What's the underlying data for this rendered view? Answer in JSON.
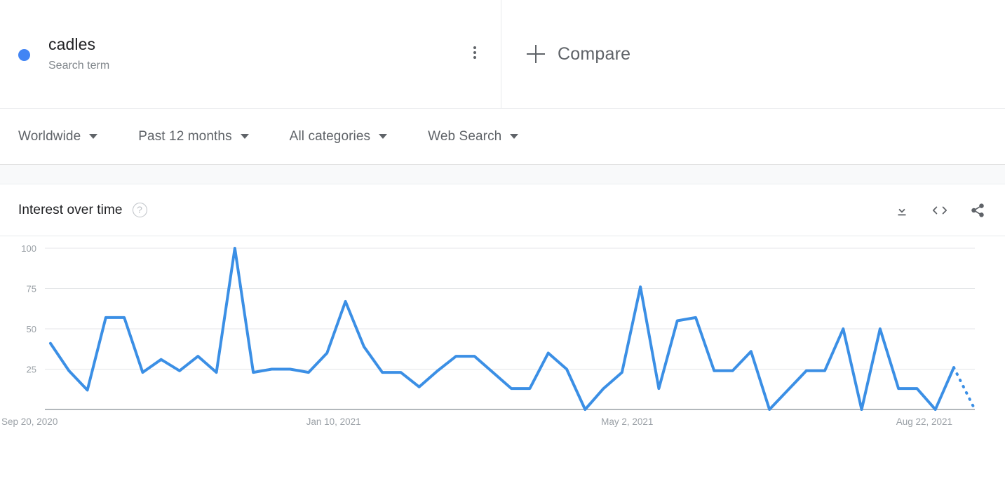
{
  "term": {
    "dot_color": "#4285F4",
    "title": "cadles",
    "subtitle": "Search term",
    "menu_icon": "more-vert-icon"
  },
  "compare": {
    "plus_icon": "plus-icon",
    "label": "Compare"
  },
  "filters": [
    {
      "label": "Worldwide",
      "icon": "chevron-down-icon"
    },
    {
      "label": "Past 12 months",
      "icon": "chevron-down-icon"
    },
    {
      "label": "All categories",
      "icon": "chevron-down-icon"
    },
    {
      "label": "Web Search",
      "icon": "chevron-down-icon"
    }
  ],
  "card": {
    "title": "Interest over time",
    "help_icon": "help-circle-icon",
    "help_glyph": "?",
    "actions": [
      {
        "name": "download-icon"
      },
      {
        "name": "embed-icon"
      },
      {
        "name": "share-icon"
      }
    ]
  },
  "chart_data": {
    "type": "line",
    "title": "Interest over time",
    "xlabel": "",
    "ylabel": "",
    "ylim": [
      0,
      100
    ],
    "yticks": [
      25,
      50,
      75,
      100
    ],
    "ytick_labels": [
      "25",
      "50",
      "75",
      "100"
    ],
    "grid": true,
    "legend": false,
    "line_color": "#3b8fe5",
    "grid_color": "#e4e6e8",
    "axis_color": "#9aa0a6",
    "xtick_labels": [
      "Sep 20, 2020",
      "Jan 10, 2021",
      "May 2, 2021",
      "Aug 22, 2021"
    ],
    "xtick_indices": [
      0,
      16,
      32,
      48
    ],
    "series": [
      {
        "name": "cadles",
        "values": [
          41,
          24,
          12,
          57,
          57,
          23,
          31,
          24,
          33,
          23,
          100,
          23,
          25,
          25,
          23,
          35,
          67,
          39,
          23,
          23,
          14,
          24,
          33,
          33,
          23,
          13,
          13,
          35,
          25,
          0,
          13,
          23,
          76,
          13,
          55,
          57,
          24,
          24,
          36,
          0,
          12,
          24,
          24,
          50,
          0,
          50,
          13,
          13,
          0,
          26
        ]
      }
    ],
    "forecast_segment": {
      "note": "dotted trailing segment indicating incomplete/partial data",
      "from_index": 49,
      "from_value": 26,
      "to_value": 0,
      "style": "dotted"
    }
  }
}
